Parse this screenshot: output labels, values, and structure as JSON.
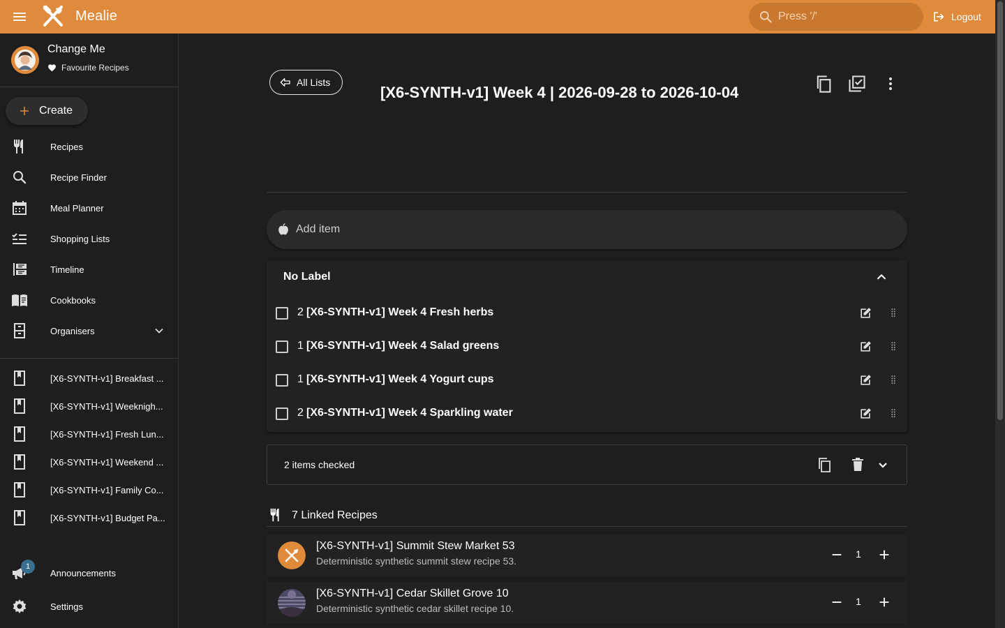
{
  "app": {
    "brand": "Mealie"
  },
  "search": {
    "placeholder": "Press '/'"
  },
  "header": {
    "logout_label": "Logout"
  },
  "user": {
    "name": "Change Me",
    "favourites_label": "Favourite Recipes"
  },
  "sidebar": {
    "create_label": "Create",
    "nav": [
      {
        "label": "Recipes",
        "icon": "fork-knife-icon"
      },
      {
        "label": "Recipe Finder",
        "icon": "search-icon"
      },
      {
        "label": "Meal Planner",
        "icon": "calendar-icon"
      },
      {
        "label": "Shopping Lists",
        "icon": "checklist-icon"
      },
      {
        "label": "Timeline",
        "icon": "timeline-icon"
      },
      {
        "label": "Cookbooks",
        "icon": "book-open-icon"
      },
      {
        "label": "Organisers",
        "icon": "file-cabinet-icon"
      }
    ],
    "cookbooks": [
      {
        "label": "[X6-SYNTH-v1] Breakfast ..."
      },
      {
        "label": "[X6-SYNTH-v1] Weeknigh..."
      },
      {
        "label": "[X6-SYNTH-v1] Fresh Lun..."
      },
      {
        "label": "[X6-SYNTH-v1] Weekend ..."
      },
      {
        "label": "[X6-SYNTH-v1] Family Co..."
      },
      {
        "label": "[X6-SYNTH-v1] Budget Pa..."
      }
    ],
    "announcements_label": "Announcements",
    "announcements_badge": "1",
    "settings_label": "Settings"
  },
  "main": {
    "all_lists_label": "All Lists",
    "title": "[X6-SYNTH-v1] Week 4 | 2026-09-28 to 2026-10-04",
    "add_item_placeholder": "Add item",
    "group_label": "No Label",
    "items": [
      {
        "qty": "2",
        "name": "[X6-SYNTH-v1] Week 4 Fresh herbs"
      },
      {
        "qty": "1",
        "name": "[X6-SYNTH-v1] Week 4 Salad greens"
      },
      {
        "qty": "1",
        "name": "[X6-SYNTH-v1] Week 4 Yogurt cups"
      },
      {
        "qty": "2",
        "name": "[X6-SYNTH-v1] Week 4 Sparkling water"
      }
    ],
    "checked_summary": "2 items checked",
    "linked_recipes_label": "7 Linked Recipes",
    "recipes": [
      {
        "title": "[X6-SYNTH-v1] Summit Stew Market 53",
        "description": "Deterministic synthetic summit stew recipe 53.",
        "count": "1"
      },
      {
        "title": "[X6-SYNTH-v1] Cedar Skillet Grove 10",
        "description": "Deterministic synthetic cedar skillet recipe 10.",
        "count": "1"
      }
    ]
  },
  "colors": {
    "accent": "#e08b3c",
    "background": "#1e1e1e",
    "surface": "#222222",
    "badge": "#3a6e8f"
  }
}
